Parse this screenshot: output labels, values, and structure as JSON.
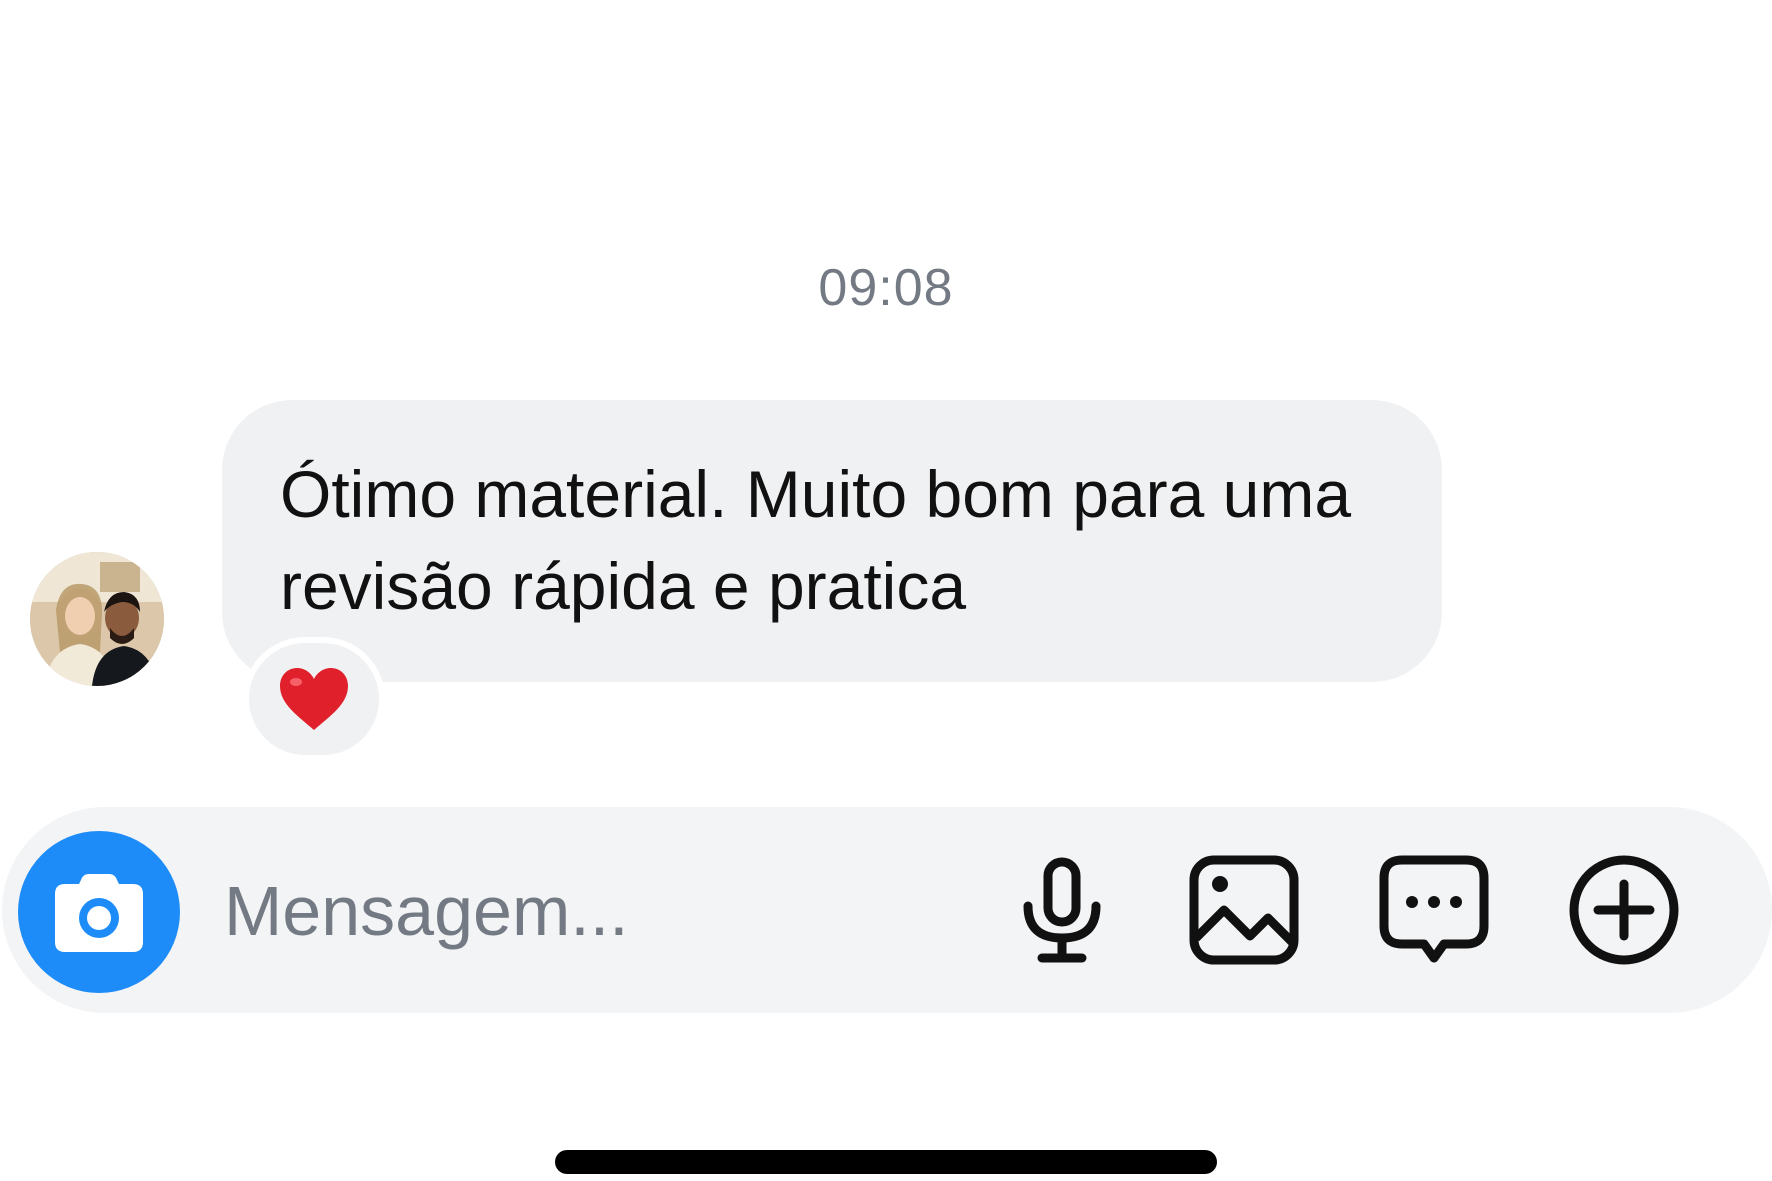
{
  "chat": {
    "timestamp": "09:08",
    "message": {
      "text": "Ótimo material. Muito bom para uma revisão rápida e pratica",
      "reaction": "heart-emoji",
      "reaction_color": "#e0202a"
    },
    "sender_avatar": "avatar"
  },
  "composer": {
    "placeholder": "Mensagem...",
    "value": "",
    "camera_button": "camera-icon",
    "buttons": [
      "microphone-icon",
      "image-icon",
      "sticker-message-icon",
      "plus-circle-icon"
    ]
  },
  "colors": {
    "accent": "#1d8cf8",
    "bubble": "#f0f1f3",
    "muted_text": "#737a84"
  }
}
